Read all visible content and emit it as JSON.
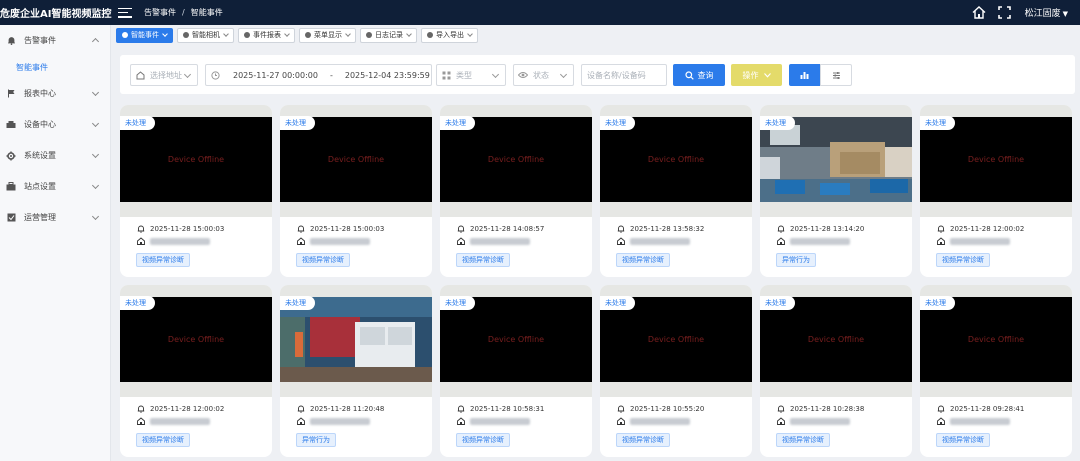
{
  "header": {
    "app_title": "危废企业AI智能视频监控",
    "breadcrumb": [
      "告警事件",
      "/",
      "智能事件"
    ],
    "user_name": "松江固废"
  },
  "sidebar": {
    "items": [
      {
        "label": "告警事件",
        "icon": "bell-icon",
        "expanded": true
      },
      {
        "label": "报表中心",
        "icon": "flag-icon",
        "expanded": false
      },
      {
        "label": "设备中心",
        "icon": "device-icon",
        "expanded": false
      },
      {
        "label": "系统设置",
        "icon": "gear-icon",
        "expanded": false
      },
      {
        "label": "站点设置",
        "icon": "briefcase-icon",
        "expanded": false
      },
      {
        "label": "运营管理",
        "icon": "box-icon",
        "expanded": false
      }
    ],
    "sub_item": "智能事件"
  },
  "tabs": [
    "智能事件",
    "智能相机",
    "事件报表",
    "菜单显示",
    "日志记录",
    "导入导出"
  ],
  "filters": {
    "address_placeholder": "选择地址",
    "date_start": "2025-11-27 00:00:00",
    "date_sep": "-",
    "date_end": "2025-12-04 23:59:59",
    "type_placeholder": "类型",
    "status_placeholder": "状态",
    "device_placeholder": "设备名称/设备码",
    "query_label": "查询",
    "ops_label": "操作"
  },
  "offline_text": "Device Offline",
  "cards": [
    {
      "status": "未处理",
      "time": "2025-11-28 15:00:03",
      "tag": "视频异常诊断",
      "offline": true
    },
    {
      "status": "未处理",
      "time": "2025-11-28 15:00:03",
      "tag": "视频异常诊断",
      "offline": true
    },
    {
      "status": "未处理",
      "time": "2025-11-28 14:08:57",
      "tag": "视频异常诊断",
      "offline": true
    },
    {
      "status": "未处理",
      "time": "2025-11-28 13:58:32",
      "tag": "视频异常诊断",
      "offline": true
    },
    {
      "status": "未处理",
      "time": "2025-11-28 13:14:20",
      "tag": "异常行为",
      "offline": false
    },
    {
      "status": "未处理",
      "time": "2025-11-28 12:00:02",
      "tag": "视频异常诊断",
      "offline": true
    },
    {
      "status": "未处理",
      "time": "2025-11-28 12:00:02",
      "tag": "视频异常诊断",
      "offline": true
    },
    {
      "status": "未处理",
      "time": "2025-11-28 11:20:48",
      "tag": "异常行为",
      "offline": false
    },
    {
      "status": "未处理",
      "time": "2025-11-28 10:58:31",
      "tag": "视频异常诊断",
      "offline": true
    },
    {
      "status": "未处理",
      "time": "2025-11-28 10:55:20",
      "tag": "视频异常诊断",
      "offline": true
    },
    {
      "status": "未处理",
      "time": "2025-11-28 10:28:38",
      "tag": "视频异常诊断",
      "offline": true
    },
    {
      "status": "未处理",
      "time": "2025-11-28 09:28:41",
      "tag": "视频异常诊断",
      "offline": true
    }
  ],
  "colors": {
    "topbar": "#0f1f38",
    "accent": "#2b7bea",
    "ops_button": "#e4db6a"
  }
}
